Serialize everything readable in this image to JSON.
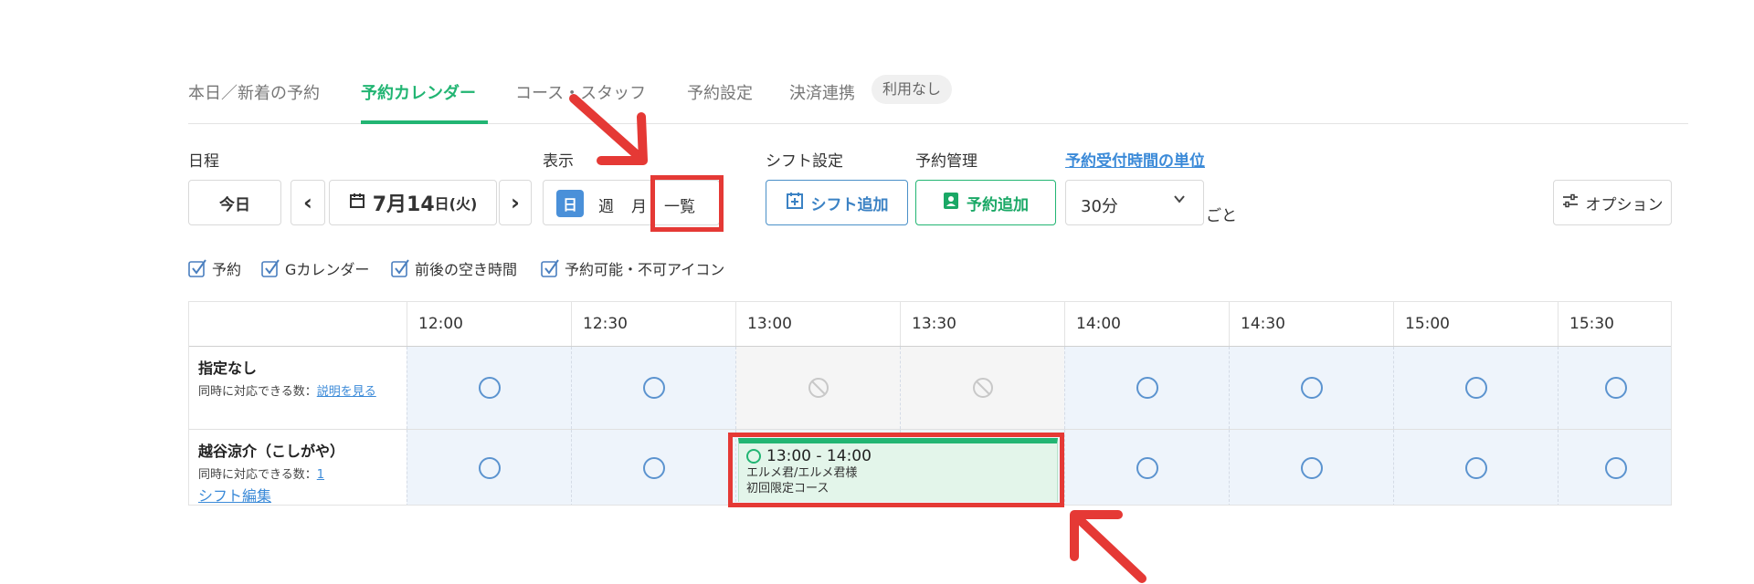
{
  "tabs": [
    {
      "label": "本日／新着の予約"
    },
    {
      "label": "予約カレンダー"
    },
    {
      "label": "コース・スタッフ"
    },
    {
      "label": "予約設定"
    },
    {
      "label": "決済連携"
    }
  ],
  "tab_badge": "利用なし",
  "labels": {
    "schedule": "日程",
    "display": "表示",
    "shift_settings": "シフト設定",
    "reservation_mgmt": "予約管理",
    "time_unit_link": "予約受付時間の単位"
  },
  "toolbar": {
    "today": "今日",
    "prev": "‹",
    "date": "7月14",
    "day": "日(火)",
    "next": "›",
    "view_day": "日",
    "view_week": "週",
    "view_month": "月",
    "view_list": "一覧",
    "add_shift": "シフト追加",
    "add_reservation": "予約追加",
    "unit_value": "30分",
    "unit_suffix": "ごと",
    "options": "オプション"
  },
  "checkboxes": [
    {
      "label": "予約",
      "checked": true
    },
    {
      "label": "Gカレンダー",
      "checked": true
    },
    {
      "label": "前後の空き時間",
      "checked": true
    },
    {
      "label": "予約可能・不可アイコン",
      "checked": true
    }
  ],
  "grid": {
    "times": [
      "12:00",
      "12:30",
      "13:00",
      "13:30",
      "14:00",
      "14:30",
      "15:00",
      "15:30"
    ],
    "rows": [
      {
        "name": "指定なし",
        "sub_text": "同時に対応できる数：",
        "sub_link": "説明を見る",
        "status": [
          "available",
          "available",
          "unavailable",
          "unavailable",
          "available",
          "available",
          "available",
          "available"
        ]
      },
      {
        "name": "越谷涼介（こしがや）",
        "sub_text": "同時に対応できる数：",
        "sub_link": "1",
        "edit_link": "シフト編集",
        "status": [
          "available",
          "available",
          "booked",
          "booked",
          "available",
          "available",
          "available",
          "available"
        ]
      }
    ]
  },
  "booking": {
    "time": "13:00 - 14:00",
    "customer": "エルメ君/エルメ君様",
    "course": "初回限定コース"
  },
  "colors": {
    "accent_green": "#22b573",
    "accent_blue": "#4a90d9",
    "annotation_red": "#e53935"
  }
}
